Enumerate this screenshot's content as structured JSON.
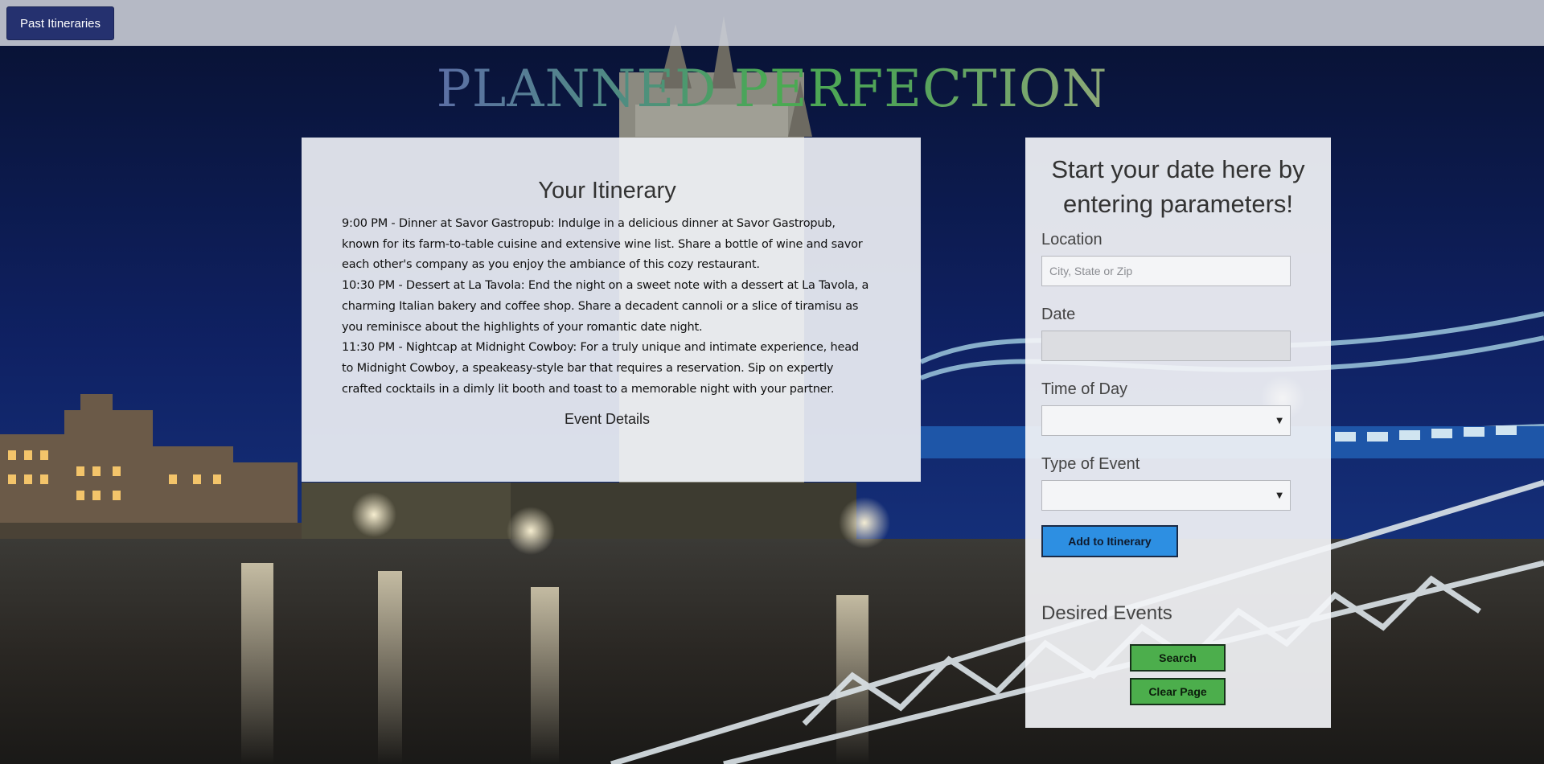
{
  "topbar": {
    "past_itineraries_label": "Past Itineraries"
  },
  "brand": {
    "title": "PLANNED PERFECTION"
  },
  "itinerary": {
    "title": "Your Itinerary",
    "entries": [
      "9:00 PM - Dinner at Savor Gastropub: Indulge in a delicious dinner at Savor Gastropub, known for its farm-to-table cuisine and extensive wine list. Share a bottle of wine and savor each other's company as you enjoy the ambiance of this cozy restaurant.",
      "10:30 PM - Dessert at La Tavola: End the night on a sweet note with a dessert at La Tavola, a charming Italian bakery and coffee shop. Share a decadent cannoli or a slice of tiramisu as you reminisce about the highlights of your romantic date night.",
      "11:30 PM - Nightcap at Midnight Cowboy: For a truly unique and intimate experience, head to Midnight Cowboy, a speakeasy-style bar that requires a reservation. Sip on expertly crafted cocktails in a dimly lit booth and toast to a memorable night with your partner."
    ],
    "event_details_label": "Event Details"
  },
  "form": {
    "title": "Start your date here by entering parameters!",
    "location_label": "Location",
    "location_placeholder": "City, State or Zip",
    "location_value": "",
    "date_label": "Date",
    "date_value": "",
    "time_label": "Time of Day",
    "time_value": "",
    "type_label": "Type of Event",
    "type_value": "",
    "add_button_label": "Add to Itinerary",
    "desired_title": "Desired Events",
    "search_label": "Search",
    "clear_label": "Clear Page"
  },
  "colors": {
    "nav_button": "#25316f",
    "add_button": "#2d8fe2",
    "green_button": "#4cae4c",
    "sky": "#0d1a4a"
  }
}
